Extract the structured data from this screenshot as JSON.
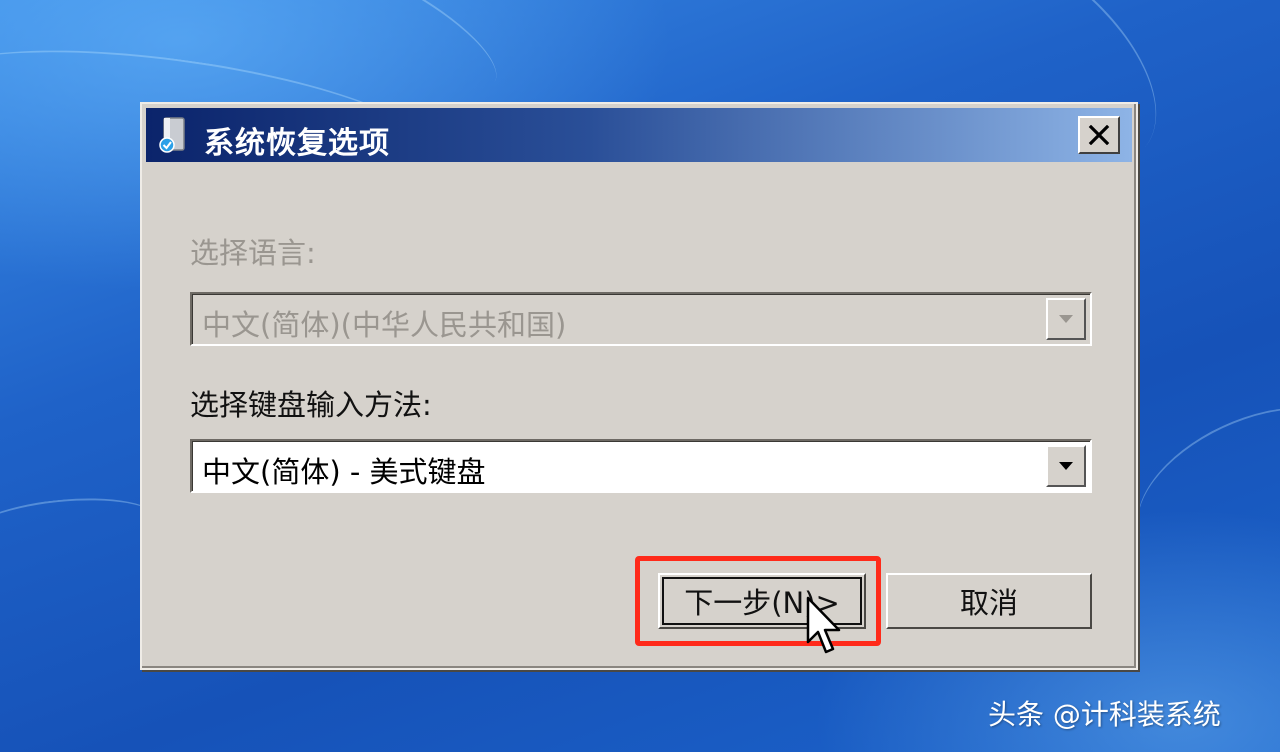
{
  "dialog": {
    "title": "系统恢复选项",
    "language_label": "选择语言:",
    "language_value": "中文(简体)(中华人民共和国)",
    "keyboard_label": "选择键盘输入方法:",
    "keyboard_value": "中文(简体) - 美式键盘",
    "next_button": "下一步(N)>",
    "cancel_button": "取消",
    "close_icon": "close-icon",
    "title_icon": "recovery-disk-icon"
  },
  "watermark": "头条 @计科装系统",
  "colors": {
    "highlight": "#ff2a1a",
    "titlebar_start": "#0b246b",
    "titlebar_end": "#8eb4e6",
    "dialog_face": "#d6d2cc"
  }
}
